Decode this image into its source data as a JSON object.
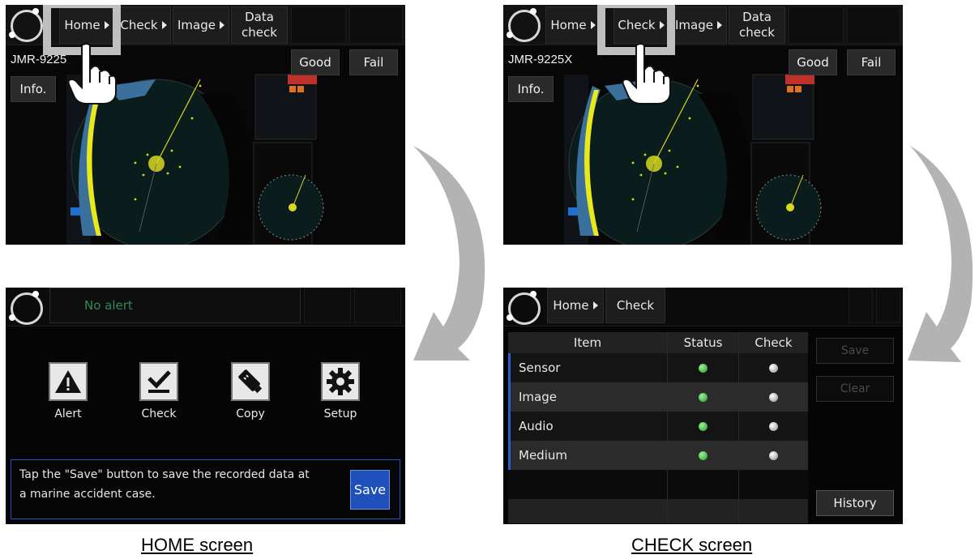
{
  "top_left": {
    "nav": {
      "home": "Home",
      "check": "Check",
      "image": "Image",
      "data_check_line1": "Data",
      "data_check_line2": "check"
    },
    "model": "JMR-9225",
    "good": "Good",
    "fail": "Fail",
    "info": "Info."
  },
  "top_right": {
    "nav": {
      "home": "Home",
      "check": "Check",
      "image": "Image",
      "data_check_line1": "Data",
      "data_check_line2": "check"
    },
    "model": "JMR-9225X",
    "good": "Good",
    "fail": "Fail",
    "info": "Info."
  },
  "home_screen": {
    "alert_status": "No alert",
    "buttons": [
      {
        "label": "Alert",
        "icon": "warning-icon"
      },
      {
        "label": "Check",
        "icon": "checkmark-icon"
      },
      {
        "label": "Copy",
        "icon": "usb-drive-icon"
      },
      {
        "label": "Setup",
        "icon": "gear-icon"
      }
    ],
    "message_line1": "Tap the \"Save\" button to save the recorded data at",
    "message_line2": "a marine accident case.",
    "save": "Save"
  },
  "check_screen": {
    "breadcrumb_home": "Home",
    "breadcrumb_check": "Check",
    "columns": [
      "Item",
      "Status",
      "Check"
    ],
    "rows": [
      {
        "item": "Sensor",
        "status": "green",
        "check": "white"
      },
      {
        "item": "Image",
        "status": "green",
        "check": "white"
      },
      {
        "item": "Audio",
        "status": "green",
        "check": "white"
      },
      {
        "item": "Medium",
        "status": "green",
        "check": "white"
      }
    ],
    "save": "Save",
    "clear": "Clear",
    "history": "History"
  },
  "captions": {
    "home": "HOME screen",
    "check": "CHECK screen"
  },
  "colors": {
    "status_green": "#2fbf2f",
    "accent_blue": "#1f4fb8",
    "highlight_gray": "#bfbfbf"
  }
}
